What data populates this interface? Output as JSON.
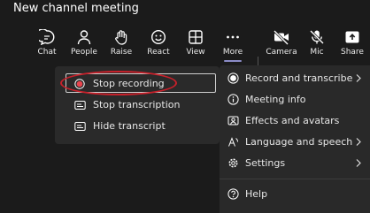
{
  "window": {
    "title": "New channel meeting"
  },
  "toolbar": {
    "chat": "Chat",
    "people": "People",
    "raise": "Raise",
    "react": "React",
    "view": "View",
    "more": "More",
    "camera": "Camera",
    "mic": "Mic",
    "share": "Share"
  },
  "submenu": {
    "items": [
      "Stop recording",
      "Stop transcription",
      "Hide transcript"
    ]
  },
  "menu": {
    "items": [
      "Record and transcribe",
      "Meeting info",
      "Effects and avatars",
      "Language and speech",
      "Settings",
      "Help"
    ]
  },
  "colors": {
    "background": "#1b1b1b",
    "menu_bg": "#292929",
    "recording_red": "#e8454e",
    "annotation_red": "#c9202a",
    "accent": "#8b8cc7"
  },
  "icons": {
    "chat": "chat-icon",
    "people": "people-icon",
    "raise": "hand-icon",
    "react": "smiley-icon",
    "view": "grid-icon",
    "more": "ellipsis-icon",
    "camera": "camera-off-icon",
    "mic": "mic-off-icon",
    "share": "share-icon"
  }
}
